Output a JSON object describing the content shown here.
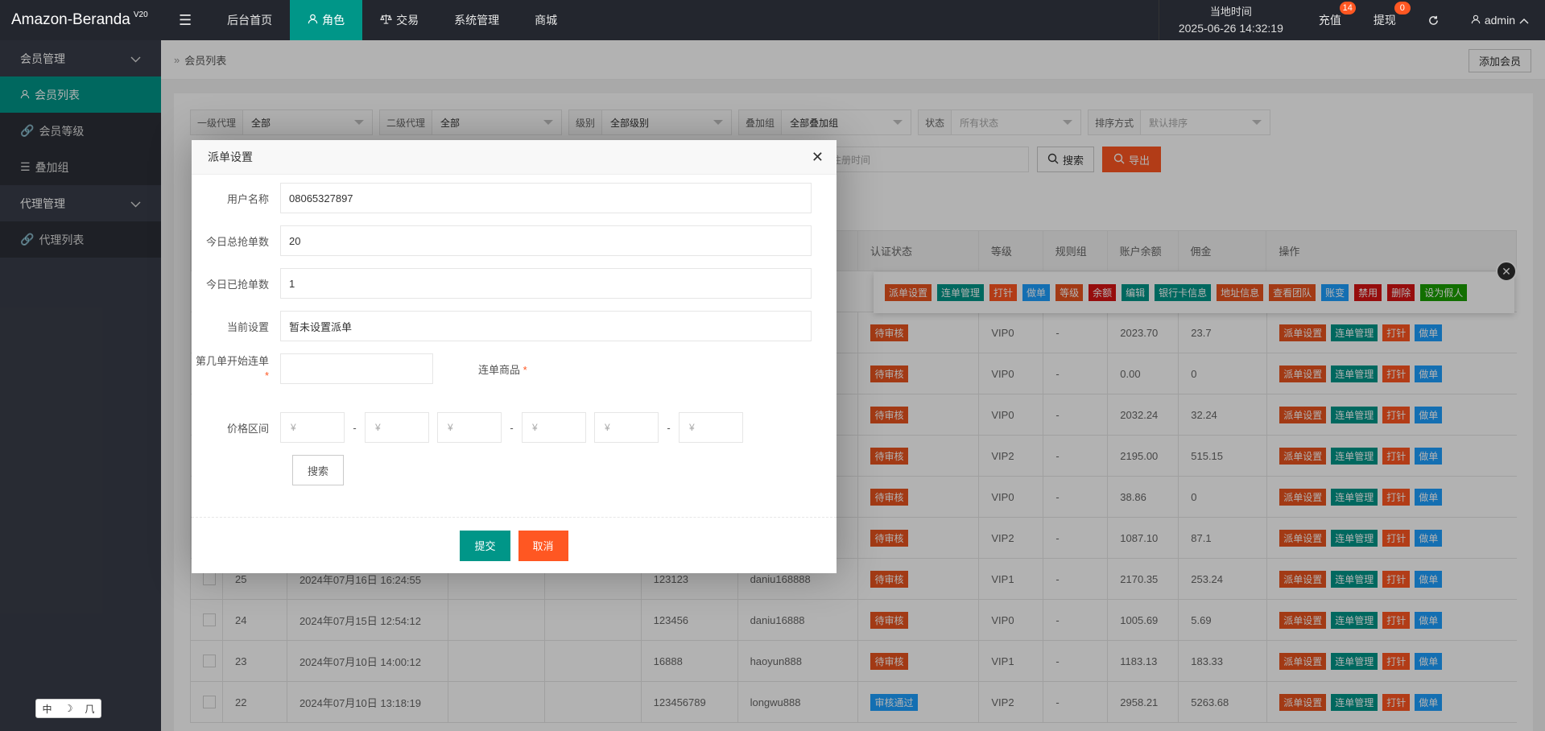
{
  "app": {
    "logo": "Amazon-Beranda",
    "version": "V20"
  },
  "topnav": [
    {
      "label": "后台首页"
    },
    {
      "label": "角色"
    },
    {
      "label": "交易"
    },
    {
      "label": "系统管理"
    },
    {
      "label": "商城"
    }
  ],
  "header": {
    "time_label": "当地时间",
    "time_value": "2025-06-26 14:32:19",
    "recharge": "充值",
    "recharge_badge": "14",
    "withdraw": "提现",
    "withdraw_badge": "0",
    "user": "admin"
  },
  "sidebar": {
    "group1": "会员管理",
    "items1": [
      "会员列表",
      "会员等级",
      "叠加组"
    ],
    "group2": "代理管理",
    "items2": [
      "代理列表"
    ]
  },
  "ime": [
    "中",
    "☽",
    "⺇"
  ],
  "breadcrumb": "会员列表",
  "add_member": "添加会员",
  "filters": [
    {
      "label": "一级代理",
      "value": "全部",
      "placeholder": false
    },
    {
      "label": "二级代理",
      "value": "全部",
      "placeholder": false
    },
    {
      "label": "级别",
      "value": "全部级别",
      "placeholder": false
    },
    {
      "label": "叠加组",
      "value": "全部叠加组",
      "placeholder": false
    },
    {
      "label": "状态",
      "value": "所有状态",
      "placeholder": true
    },
    {
      "label": "排序方式",
      "value": "默认排序",
      "placeholder": true
    }
  ],
  "date_placeholder": "请选择注册时间",
  "search_btn": "搜索",
  "export_btn": "导出",
  "table": {
    "headers": [
      "认证状态",
      "等级",
      "规则组",
      "账户余额",
      "佣金",
      "操作"
    ],
    "rows": [
      {
        "id": "",
        "time": "",
        "invite": "",
        "user": "",
        "status": "待审核",
        "level": "VIP0",
        "rule": "-",
        "balance": "2023.70",
        "commission": "23.7"
      },
      {
        "id": "",
        "time": "",
        "invite": "",
        "user": "",
        "status": "待审核",
        "level": "VIP0",
        "rule": "-",
        "balance": "0.00",
        "commission": "0"
      },
      {
        "id": "",
        "time": "",
        "invite": "",
        "user": "",
        "status": "待审核",
        "level": "VIP0",
        "rule": "-",
        "balance": "2032.24",
        "commission": "32.24"
      },
      {
        "id": "",
        "time": "",
        "invite": "",
        "user": "",
        "status": "待审核",
        "level": "VIP2",
        "rule": "-",
        "balance": "2195.00",
        "commission": "515.15"
      },
      {
        "id": "",
        "time": "",
        "invite": "",
        "user": "",
        "status": "待审核",
        "level": "VIP0",
        "rule": "-",
        "balance": "38.86",
        "commission": "0"
      },
      {
        "id": "",
        "time": "",
        "invite": "",
        "user": "",
        "status": "待审核",
        "level": "VIP2",
        "rule": "-",
        "balance": "1087.10",
        "commission": "87.1"
      },
      {
        "id": "25",
        "time": "2024年07月16日 16:24:55",
        "invite": "123123",
        "user": "daniu168888",
        "status": "待审核",
        "level": "VIP1",
        "rule": "-",
        "balance": "2170.35",
        "commission": "253.24"
      },
      {
        "id": "24",
        "time": "2024年07月15日 12:54:12",
        "invite": "123456",
        "user": "daniu16888",
        "status": "待审核",
        "level": "VIP0",
        "rule": "-",
        "balance": "1005.69",
        "commission": "5.69"
      },
      {
        "id": "23",
        "time": "2024年07月10日 14:00:12",
        "invite": "16888",
        "user": "haoyun888",
        "status": "待审核",
        "level": "VIP1",
        "rule": "-",
        "balance": "1183.13",
        "commission": "183.33"
      },
      {
        "id": "22",
        "time": "2024年07月10日 13:18:19",
        "invite": "123456789",
        "user": "longwu888",
        "status": "审核通过",
        "level": "VIP2",
        "rule": "-",
        "balance": "2958.21",
        "commission": "5263.68"
      }
    ],
    "row_ops": [
      "派单设置",
      "连单管理",
      "打针",
      "做单"
    ]
  },
  "ops_popup": [
    "派单设置",
    "连单管理",
    "打针",
    "做单",
    "等级",
    "余额",
    "编辑",
    "银行卡信息",
    "地址信息",
    "查看团队",
    "账变",
    "禁用",
    "删除",
    "设为假人"
  ],
  "ops_close": "✕",
  "modal": {
    "title": "派单设置",
    "username_label": "用户名称",
    "username": "08065327897",
    "total_label": "今日总抢单数",
    "total": "20",
    "done_label": "今日已抢单数",
    "done": "1",
    "current_label": "当前设置",
    "current": "暂未设置派单",
    "nth_label": "第几单开始连单",
    "nth_required": "*",
    "goods_label": "连单商品",
    "goods_required": "*",
    "price_label": "价格区间",
    "price_placeholder": "¥",
    "dash": "-",
    "search": "搜索",
    "submit": "提交",
    "cancel": "取消"
  },
  "colors": {
    "accent": "#009688",
    "orange": "#ff5722",
    "header": "#23262e",
    "sidebar": "#393d49"
  }
}
